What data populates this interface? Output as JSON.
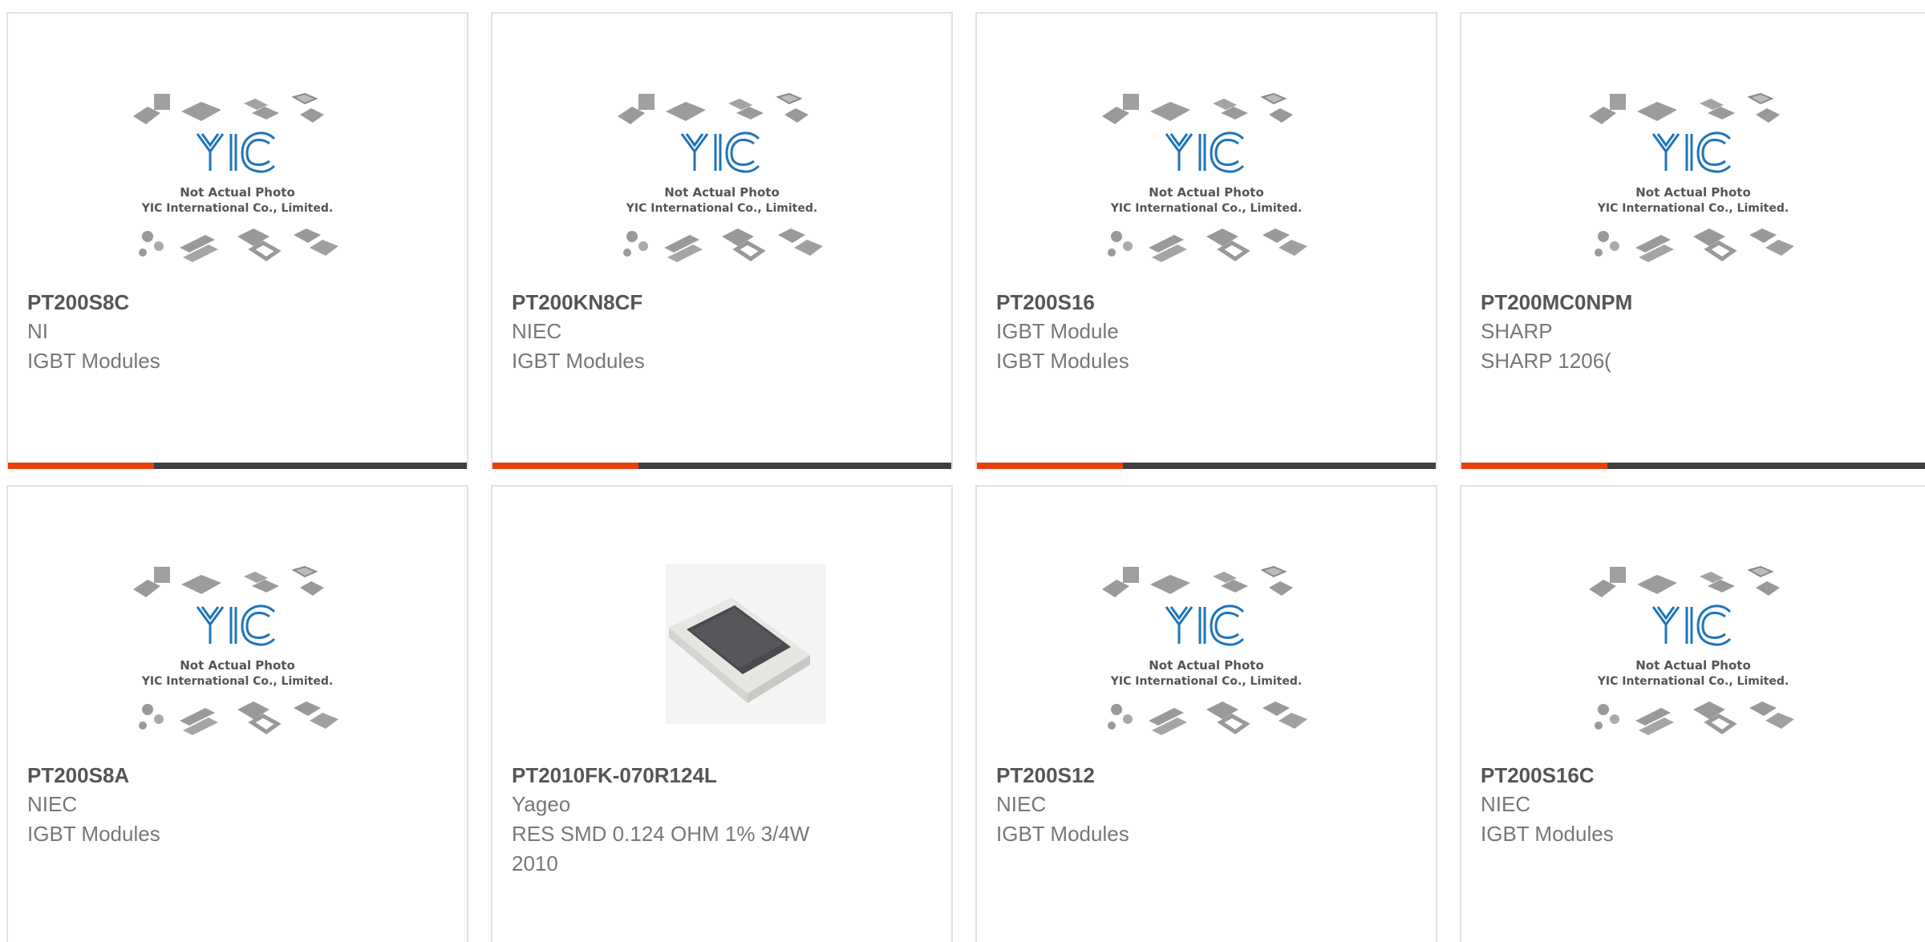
{
  "colors": {
    "accent": "#e8400c",
    "bar": "#3f3f3f",
    "logo": "#1f74b9"
  },
  "placeholder": {
    "line1": "Not Actual Photo",
    "line2": "YIC International Co., Limited.",
    "logo_text": "YIC"
  },
  "products": [
    {
      "part": "PT200S8C",
      "manufacturer": "NI",
      "description": "IGBT Modules",
      "image": "placeholder"
    },
    {
      "part": "PT200KN8CF",
      "manufacturer": "NIEC",
      "description": "IGBT Modules",
      "image": "placeholder"
    },
    {
      "part": "PT200S16",
      "manufacturer": "IGBT Module",
      "description": "IGBT Modules",
      "image": "placeholder"
    },
    {
      "part": "PT200MC0NPM",
      "manufacturer": "SHARP",
      "description": "SHARP 1206(",
      "image": "placeholder"
    },
    {
      "part": "PT200S8A",
      "manufacturer": "NIEC",
      "description": "IGBT Modules",
      "image": "placeholder"
    },
    {
      "part": "PT2010FK-070R124L",
      "manufacturer": "Yageo",
      "description": "RES SMD 0.124 OHM 1% 3/4W 2010",
      "image": "resistor-photo"
    },
    {
      "part": "PT200S12",
      "manufacturer": "NIEC",
      "description": "IGBT Modules",
      "image": "placeholder"
    },
    {
      "part": "PT200S16C",
      "manufacturer": "NIEC",
      "description": "IGBT Modules",
      "image": "placeholder"
    }
  ]
}
